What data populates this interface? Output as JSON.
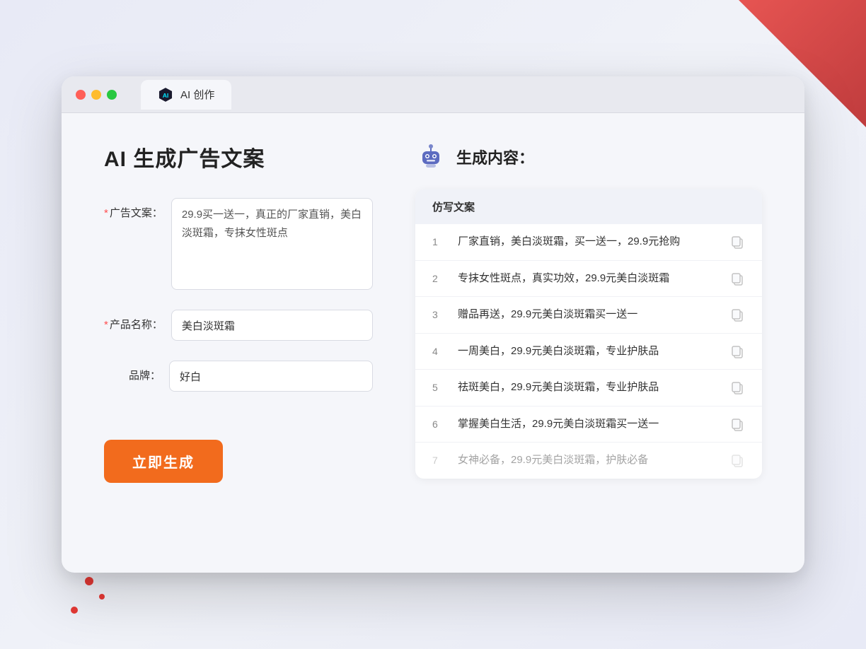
{
  "browser": {
    "tab_label": "AI 创作",
    "traffic_lights": [
      "red",
      "yellow",
      "green"
    ]
  },
  "left_panel": {
    "page_title": "AI 生成广告文案",
    "form": {
      "ad_copy_label": "广告文案：",
      "ad_copy_required": true,
      "ad_copy_value": "29.9买一送一，真正的厂家直销，美白淡斑霜，专抹女性斑点",
      "product_name_label": "产品名称：",
      "product_name_required": true,
      "product_name_value": "美白淡斑霜",
      "brand_label": "品牌：",
      "brand_required": false,
      "brand_value": "好白"
    },
    "generate_button_label": "立即生成"
  },
  "right_panel": {
    "result_title": "生成内容：",
    "table_header": "仿写文案",
    "results": [
      {
        "number": "1",
        "text": "厂家直销，美白淡斑霜，买一送一，29.9元抢购",
        "faded": false
      },
      {
        "number": "2",
        "text": "专抹女性斑点，真实功效，29.9元美白淡斑霜",
        "faded": false
      },
      {
        "number": "3",
        "text": "赠品再送，29.9元美白淡斑霜买一送一",
        "faded": false
      },
      {
        "number": "4",
        "text": "一周美白，29.9元美白淡斑霜，专业护肤品",
        "faded": false
      },
      {
        "number": "5",
        "text": "祛斑美白，29.9元美白淡斑霜，专业护肤品",
        "faded": false
      },
      {
        "number": "6",
        "text": "掌握美白生活，29.9元美白淡斑霜买一送一",
        "faded": false
      },
      {
        "number": "7",
        "text": "女神必备，29.9元美白淡斑霜，护肤必备",
        "faded": true
      }
    ]
  }
}
